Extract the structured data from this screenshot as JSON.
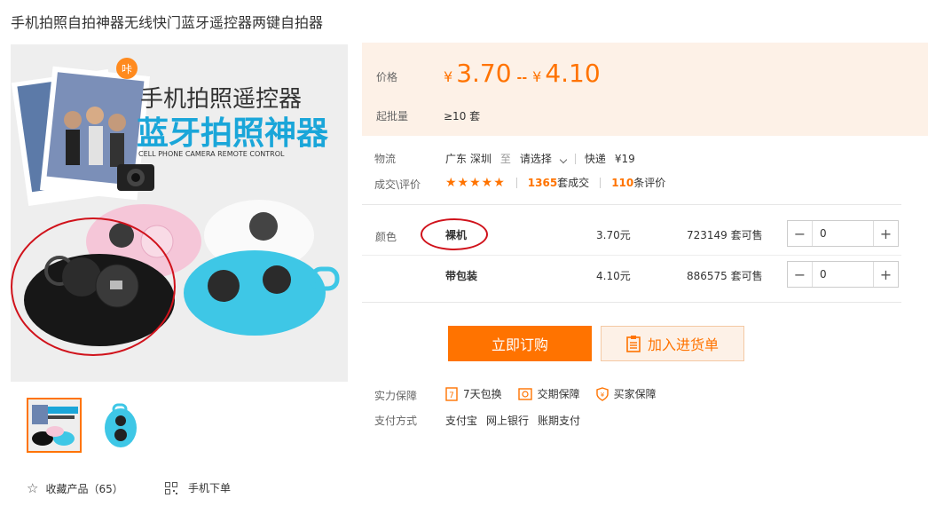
{
  "product": {
    "title": "手机拍照自拍神器无线快门蓝牙遥控器两键自拍器"
  },
  "gallery": {
    "banner_line1": "手机拍照遥控器",
    "banner_line2": "蓝牙拍照神器",
    "banner_caption": "CELL PHONE CAMERA REMOTE CONTROL",
    "banner_tag": "咔",
    "thumbnails": [
      "thumb-banner",
      "thumb-blue-remote"
    ],
    "favorite_label": "收藏产品（65）",
    "mobile_order_label": "手机下单"
  },
  "price": {
    "label": "价格",
    "currency": "¥",
    "low": "3.70",
    "separator": "--",
    "high": "4.10",
    "moq_label": "起批量",
    "moq_value": "≥10 套"
  },
  "logistics": {
    "label": "物流",
    "origin": "广东 深圳",
    "to": "至",
    "destination": "请选择",
    "method": "快递",
    "fee": "¥19"
  },
  "rating": {
    "label": "成交\\评价",
    "stars": "★★★★★",
    "deals_count": "1365",
    "deals_suffix": "套成交",
    "reviews_count": "110",
    "reviews_suffix": "条评价"
  },
  "sku": {
    "label": "颜色",
    "rows": [
      {
        "name": "裸机",
        "price": "3.70元",
        "stock": "723149 套可售",
        "qty": "0"
      },
      {
        "name": "带包装",
        "price": "4.10元",
        "stock": "886575 套可售",
        "qty": "0"
      }
    ]
  },
  "actions": {
    "buy_now": "立即订购",
    "add_to_cart": "加入进货单"
  },
  "guarantee": {
    "label": "实力保障",
    "items": [
      "7天包换",
      "交期保障",
      "买家保障"
    ]
  },
  "payment": {
    "label": "支付方式",
    "items": [
      "支付宝",
      "网上银行",
      "账期支付"
    ]
  },
  "colors": {
    "accent": "#ff7300",
    "price_bg": "#fdf1e7",
    "annotation_red": "#d0121b"
  }
}
